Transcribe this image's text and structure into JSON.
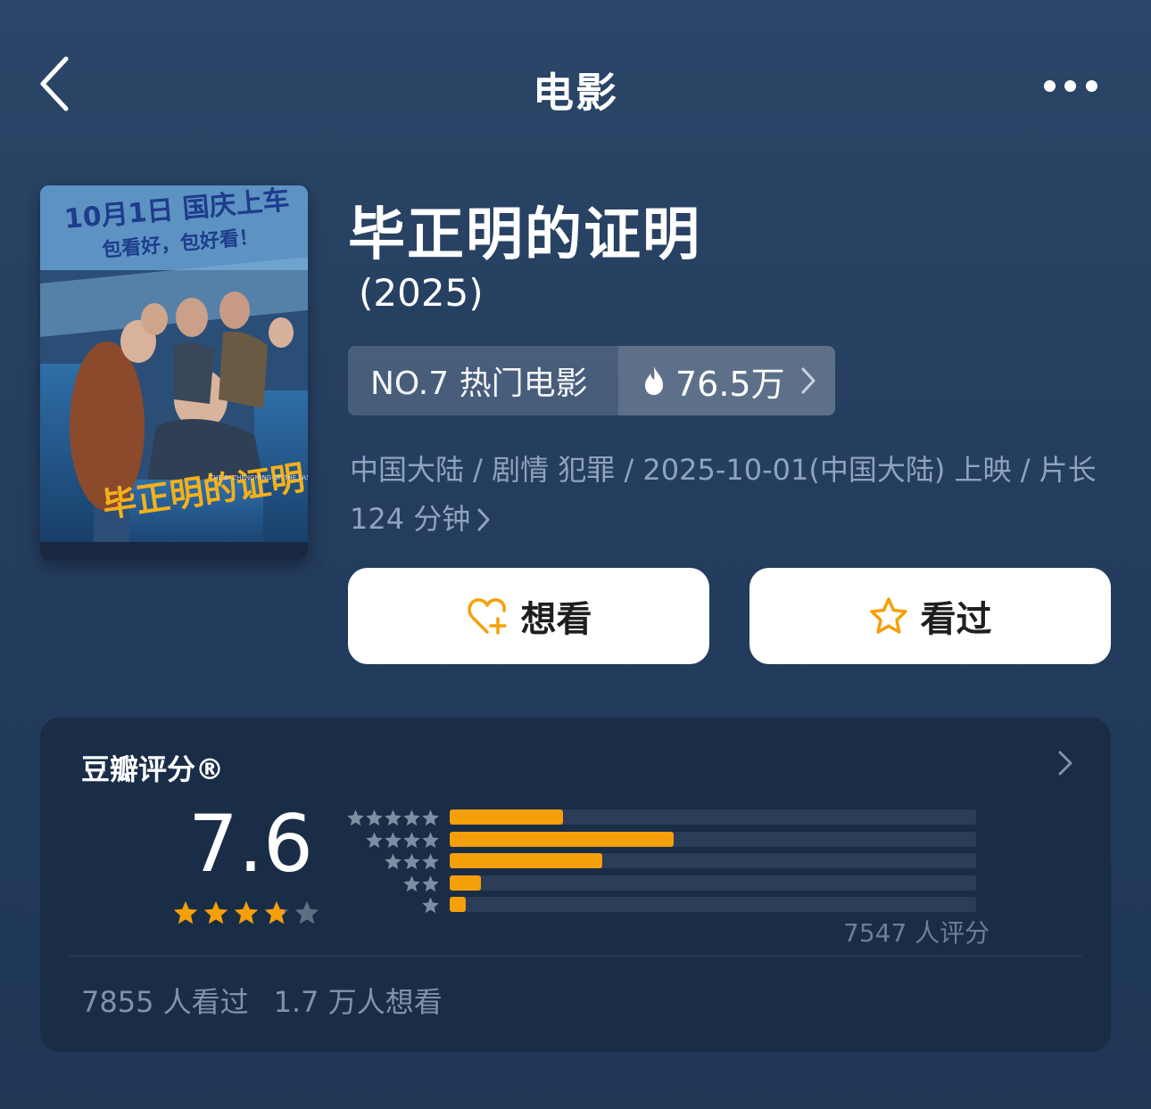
{
  "header": {
    "title": "电影"
  },
  "movie": {
    "title": "毕正明的证明",
    "year": "(2025)",
    "rank": "NO.7 热门电影",
    "heat": "76.5万",
    "meta": "中国大陆 / 剧情 犯罪 / 2025-10-01(中国大陆) 上映 / 片长 124 分钟"
  },
  "poster": {
    "headline": "10月1日 国庆上车",
    "subline": "包看好，包好看！",
    "logo_text": "毕正明的证明",
    "english_title": "THE BI ZHENGMING OF THE LAST RECORD"
  },
  "actions": {
    "want_label": "想看",
    "seen_label": "看过"
  },
  "rating": {
    "title": "豆瓣评分®",
    "score": "7.6",
    "score_stars": 3.8,
    "distribution": [
      {
        "stars": 5,
        "fraction": 0.215
      },
      {
        "stars": 4,
        "fraction": 0.425
      },
      {
        "stars": 3,
        "fraction": 0.29
      },
      {
        "stars": 2,
        "fraction": 0.06
      },
      {
        "stars": 1,
        "fraction": 0.03
      }
    ],
    "count_text": "7547 人评分",
    "seen_text": "7855 人看过",
    "want_text": "1.7 万人想看"
  },
  "colors": {
    "accent": "#f59f0a",
    "background": "#233c5d",
    "card": "#1a2d47"
  }
}
